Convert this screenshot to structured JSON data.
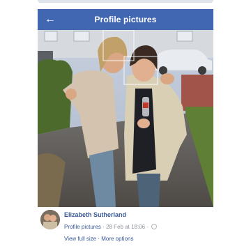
{
  "header": {
    "title": "Profile pictures",
    "back_icon": "arrow-left-icon",
    "color": "#4267b2"
  },
  "post": {
    "author": "Elizabeth Sutherland",
    "album": "Profile pictures",
    "separator": "·",
    "date": "28 Feb at 18:06",
    "dot2": "·",
    "privacy_icon": "globe-icon",
    "actions": {
      "view_full": "View full size",
      "sep": "·",
      "more": "More options"
    }
  },
  "colors": {
    "link": "#385898",
    "meta": "#90949c"
  }
}
